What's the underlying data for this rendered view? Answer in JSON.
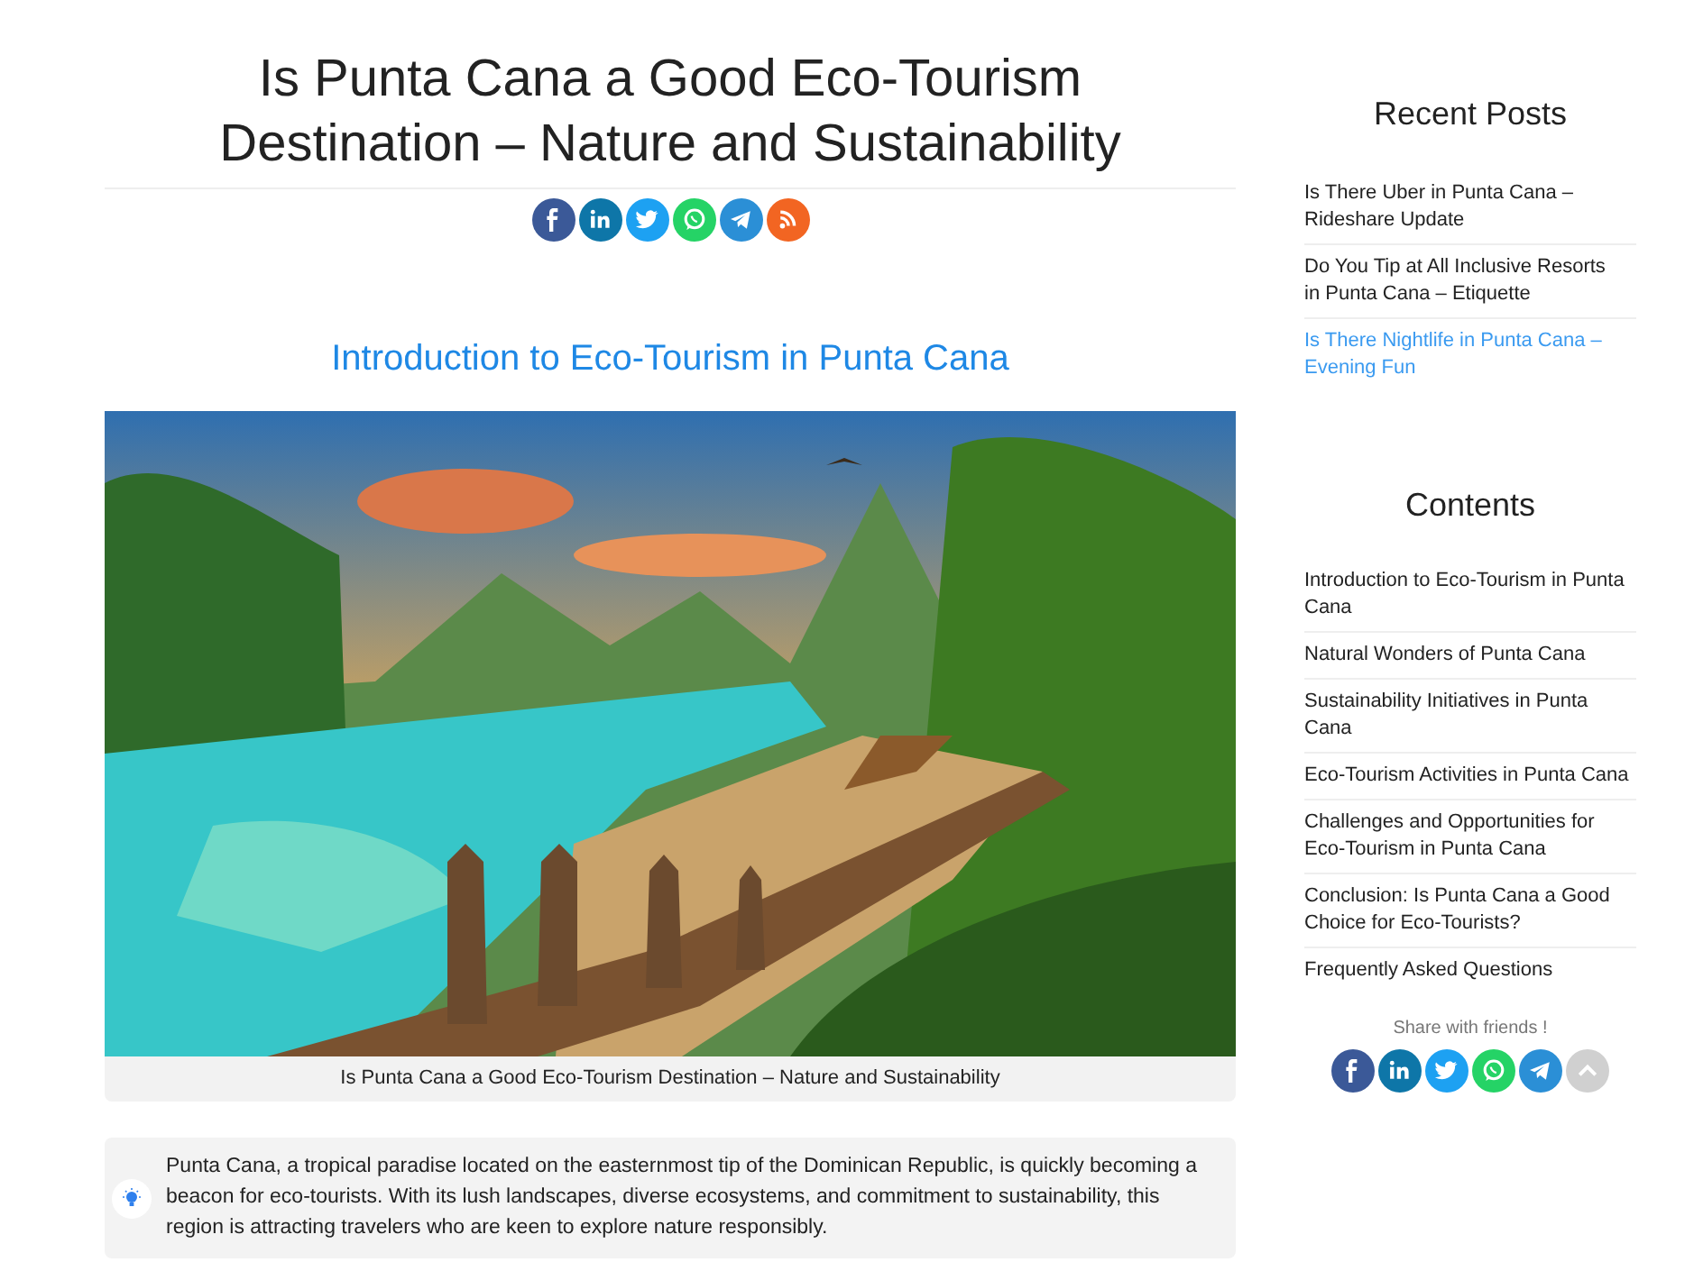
{
  "article": {
    "title": "Is Punta Cana a Good Eco-Tourism Destination – Nature and Sustainability",
    "share_buttons": [
      {
        "kind": "facebook"
      },
      {
        "kind": "linkedin"
      },
      {
        "kind": "twitter"
      },
      {
        "kind": "whatsapp"
      },
      {
        "kind": "telegram"
      },
      {
        "kind": "rss"
      }
    ],
    "section_heading": "Introduction to Eco-Tourism in Punta Cana",
    "image": {
      "kind": "picture",
      "caption": "Is Punta Cana a Good Eco-Tourism Destination – Nature and Sustainability"
    },
    "callout": "Punta Cana, a tropical paradise located on the easternmost tip of the Dominican Republic, is quickly becoming a beacon for eco-tourists. With its lush landscapes, diverse ecosystems, and commitment to sustainability, this region is attracting travelers who are keen to explore nature responsibly."
  },
  "sidebar": {
    "recent_posts": {
      "title": "Recent Posts",
      "items": [
        {
          "label": "Is There Uber in Punta Cana – Rideshare Update",
          "selected": false
        },
        {
          "label": "Do You Tip at All Inclusive Resorts in Punta Cana – Etiquette",
          "selected": false
        },
        {
          "label": "Is There Nightlife in Punta Cana – Evening Fun",
          "selected": true
        }
      ]
    },
    "contents": {
      "title": "Contents",
      "items": [
        {
          "label": "Introduction to Eco-Tourism in Punta Cana"
        },
        {
          "label": "Natural Wonders of Punta Cana"
        },
        {
          "label": "Sustainability Initiatives in Punta Cana"
        },
        {
          "label": "Eco-Tourism Activities in Punta Cana"
        },
        {
          "label": "Challenges and Opportunities for Eco-Tourism in Punta Cana"
        },
        {
          "label": "Conclusion: Is Punta Cana a Good Choice for Eco-Tourists?"
        },
        {
          "label": "Frequently Asked Questions"
        }
      ]
    },
    "share": {
      "label": "Share with friends !",
      "buttons": [
        {
          "kind": "facebook"
        },
        {
          "kind": "linkedin"
        },
        {
          "kind": "twitter"
        },
        {
          "kind": "whatsapp"
        },
        {
          "kind": "telegram"
        },
        {
          "kind": "scroll_up"
        }
      ]
    }
  }
}
